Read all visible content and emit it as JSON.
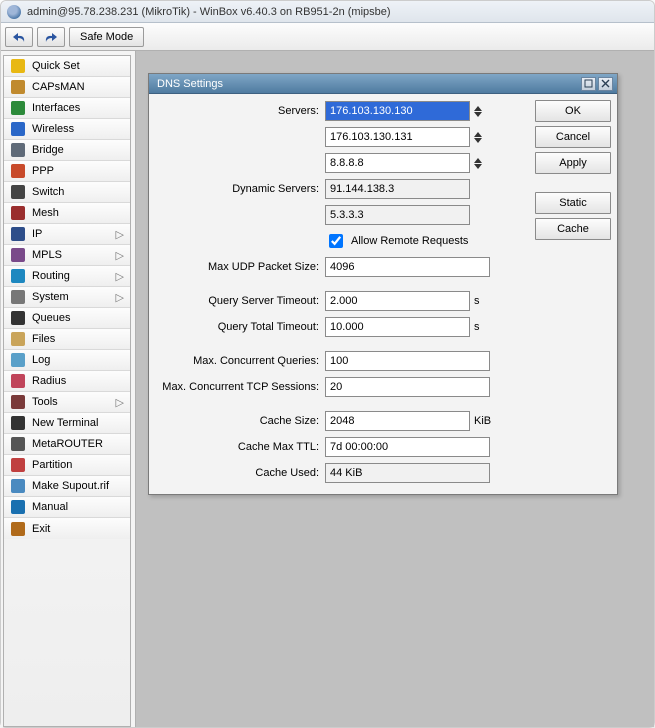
{
  "title": "admin@95.78.238.231 (MikroTik) - WinBox v6.40.3 on RB951-2n (mipsbe)",
  "toolbar": {
    "safe_mode": "Safe Mode"
  },
  "sidebar": {
    "items": [
      {
        "label": "Quick Set",
        "icon": "quickset-icon",
        "submenu": false
      },
      {
        "label": "CAPsMAN",
        "icon": "capsman-icon",
        "submenu": false
      },
      {
        "label": "Interfaces",
        "icon": "interfaces-icon",
        "submenu": false
      },
      {
        "label": "Wireless",
        "icon": "wireless-icon",
        "submenu": false
      },
      {
        "label": "Bridge",
        "icon": "bridge-icon",
        "submenu": false
      },
      {
        "label": "PPP",
        "icon": "ppp-icon",
        "submenu": false
      },
      {
        "label": "Switch",
        "icon": "switch-icon",
        "submenu": false
      },
      {
        "label": "Mesh",
        "icon": "mesh-icon",
        "submenu": false
      },
      {
        "label": "IP",
        "icon": "ip-icon",
        "submenu": true
      },
      {
        "label": "MPLS",
        "icon": "mpls-icon",
        "submenu": true
      },
      {
        "label": "Routing",
        "icon": "routing-icon",
        "submenu": true
      },
      {
        "label": "System",
        "icon": "system-icon",
        "submenu": true
      },
      {
        "label": "Queues",
        "icon": "queues-icon",
        "submenu": false
      },
      {
        "label": "Files",
        "icon": "files-icon",
        "submenu": false
      },
      {
        "label": "Log",
        "icon": "log-icon",
        "submenu": false
      },
      {
        "label": "Radius",
        "icon": "radius-icon",
        "submenu": false
      },
      {
        "label": "Tools",
        "icon": "tools-icon",
        "submenu": true
      },
      {
        "label": "New Terminal",
        "icon": "terminal-icon",
        "submenu": false
      },
      {
        "label": "MetaROUTER",
        "icon": "metarouter-icon",
        "submenu": false
      },
      {
        "label": "Partition",
        "icon": "partition-icon",
        "submenu": false
      },
      {
        "label": "Make Supout.rif",
        "icon": "supout-icon",
        "submenu": false
      },
      {
        "label": "Manual",
        "icon": "manual-icon",
        "submenu": false
      },
      {
        "label": "Exit",
        "icon": "exit-icon",
        "submenu": false
      }
    ]
  },
  "dns": {
    "title": "DNS Settings",
    "labels": {
      "servers": "Servers:",
      "dynamic_servers": "Dynamic Servers:",
      "allow_remote": "Allow Remote Requests",
      "max_udp": "Max UDP Packet Size:",
      "query_server_timeout": "Query Server Timeout:",
      "query_total_timeout": "Query Total Timeout:",
      "max_concurrent_queries": "Max. Concurrent Queries:",
      "max_concurrent_tcp": "Max. Concurrent TCP Sessions:",
      "cache_size": "Cache Size:",
      "cache_max_ttl": "Cache Max TTL:",
      "cache_used": "Cache Used:"
    },
    "values": {
      "servers": [
        "176.103.130.130",
        "176.103.130.131",
        "8.8.8.8"
      ],
      "dynamic_servers": [
        "91.144.138.3",
        "5.3.3.3"
      ],
      "allow_remote": true,
      "max_udp": "4096",
      "query_server_timeout": "2.000",
      "query_total_timeout": "10.000",
      "timeout_unit": "s",
      "max_concurrent_queries": "100",
      "max_concurrent_tcp": "20",
      "cache_size": "2048",
      "cache_size_unit": "KiB",
      "cache_max_ttl": "7d 00:00:00",
      "cache_used": "44 KiB"
    },
    "buttons": {
      "ok": "OK",
      "cancel": "Cancel",
      "apply": "Apply",
      "static": "Static",
      "cache": "Cache"
    }
  },
  "icon_colors": {
    "quickset-icon": "#e8b813",
    "capsman-icon": "#c08a2e",
    "interfaces-icon": "#2c8a3a",
    "wireless-icon": "#2a67c8",
    "bridge-icon": "#5f6a78",
    "ppp-icon": "#c84a2a",
    "switch-icon": "#444",
    "mesh-icon": "#9a2e2e",
    "ip-icon": "#2e4e8a",
    "mpls-icon": "#7a4a8a",
    "routing-icon": "#1e88c0",
    "system-icon": "#777",
    "queues-icon": "#333",
    "files-icon": "#c9a45a",
    "log-icon": "#5aa0c9",
    "radius-icon": "#c0445a",
    "tools-icon": "#7a3a3a",
    "terminal-icon": "#333",
    "metarouter-icon": "#555",
    "partition-icon": "#c04040",
    "supout-icon": "#4a8ac0",
    "manual-icon": "#1a70b0",
    "exit-icon": "#b06a1a"
  }
}
